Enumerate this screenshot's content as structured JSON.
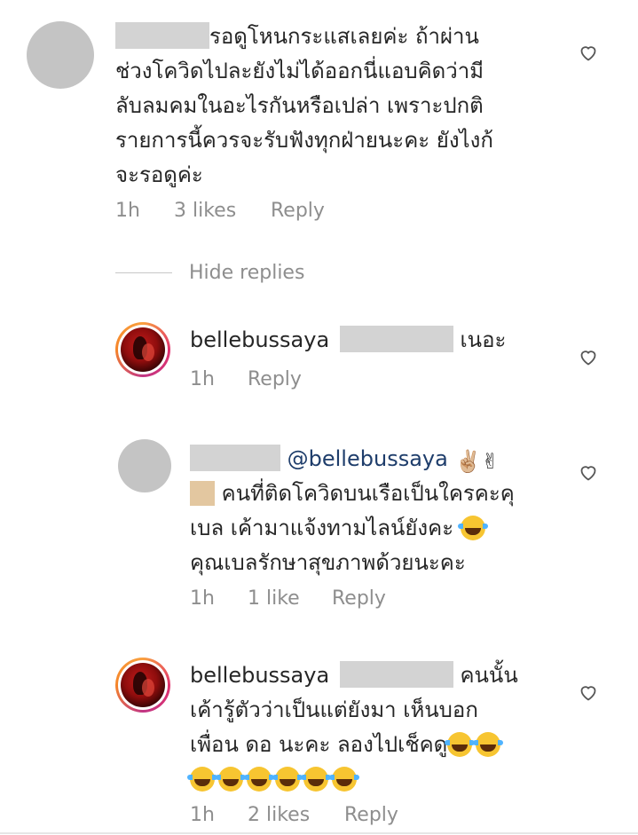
{
  "comments": [
    {
      "lines": [
        "รอดูโหนกระแสเลยค่ะ ถ้าผ่าน",
        "ช่วงโควิดไปละยังไม่ได้ออกนี่แอบคิดว่ามี",
        "ลับลมคมในอะไรกันหรือเปล่า เพราะปกติ",
        "รายการนี้ควรจะรับฟังทุกฝ่ายนะคะ ยังไงก้",
        "จะรอดูค่ะ"
      ],
      "time": "1h",
      "likes": "3 likes",
      "reply": "Reply"
    }
  ],
  "hide_replies": "Hide replies",
  "replies": [
    {
      "username": "bellebussaya",
      "line1_suffix": "เนอะ",
      "time": "1h",
      "reply": "Reply"
    },
    {
      "mention": "@bellebussaya",
      "line2": "คนที่ติดโควิดบนเรือเป็นใครคะคุ",
      "line3": "เบล เค้ามาแจ้งทามไลน์ยังคะ",
      "line4": "คุณเบลรักษาสุขภาพด้วยนะคะ",
      "emoji_victory": "✌🏼✌",
      "time": "1h",
      "likes": "1 like",
      "reply": "Reply"
    },
    {
      "username": "bellebussaya",
      "line1_suffix": "คนนั้น",
      "line2": "เค้ารู้ตัวว่าเป็นแต่ยังมา เห็นบอก",
      "line3": "เพื่อน ดอ นะคะ ลองไปเช็คดู",
      "time": "1h",
      "likes": "2 likes",
      "reply": "Reply"
    }
  ],
  "icons": {
    "like": "heart-outline-icon",
    "avatar_photo": "profile-photo"
  },
  "colors": {
    "meta": "#8e8e8e",
    "text": "#262626",
    "mention": "#1e3d6b",
    "redaction": "#d3d3d3"
  }
}
